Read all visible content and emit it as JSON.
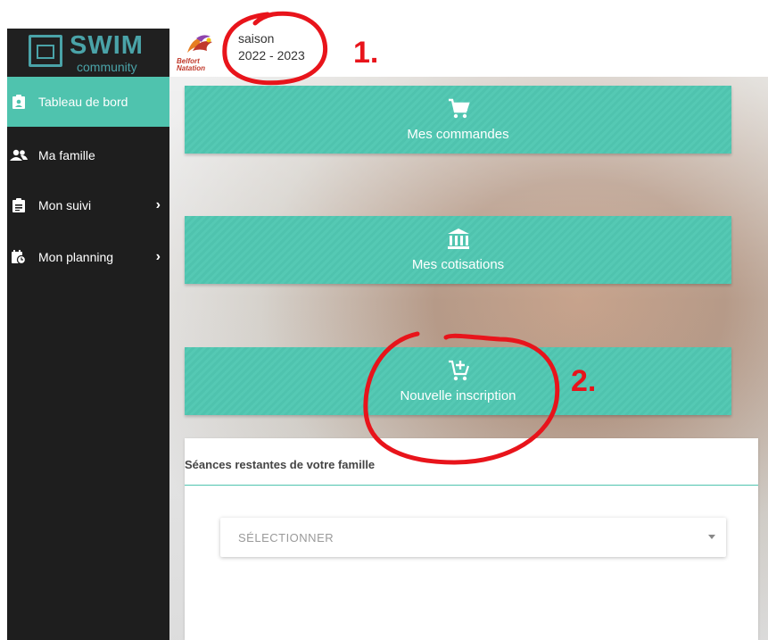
{
  "brand": {
    "name": "SWIM",
    "tagline": "community"
  },
  "club": {
    "name_line1": "Belfort",
    "name_line2": "Natation"
  },
  "season": {
    "label": "saison",
    "value": "2022 - 2023"
  },
  "sidebar": {
    "items": [
      {
        "label": "Tableau de bord",
        "icon": "clipboard-user-icon",
        "active": true
      },
      {
        "label": "Ma famille",
        "icon": "users-icon"
      },
      {
        "label": "Mon suivi",
        "icon": "clipboard-list-icon",
        "has_submenu": true
      },
      {
        "label": "Mon planning",
        "icon": "calendar-clock-icon",
        "has_submenu": true
      }
    ]
  },
  "cards": [
    {
      "label": "Mes commandes",
      "icon": "cart-icon"
    },
    {
      "label": "Mes cotisations",
      "icon": "bank-icon"
    },
    {
      "label": "Nouvelle inscription",
      "icon": "cart-plus-icon"
    }
  ],
  "panel": {
    "title": "Séances restantes de votre famille",
    "select_placeholder": "SÉLECTIONNER"
  },
  "annotations": {
    "mark1": "1.",
    "mark2": "2."
  },
  "colors": {
    "accent": "#4fc3ae",
    "sidebar": "#1e1e1e",
    "brand": "#4aa3a8",
    "annotation": "#e8141b"
  }
}
